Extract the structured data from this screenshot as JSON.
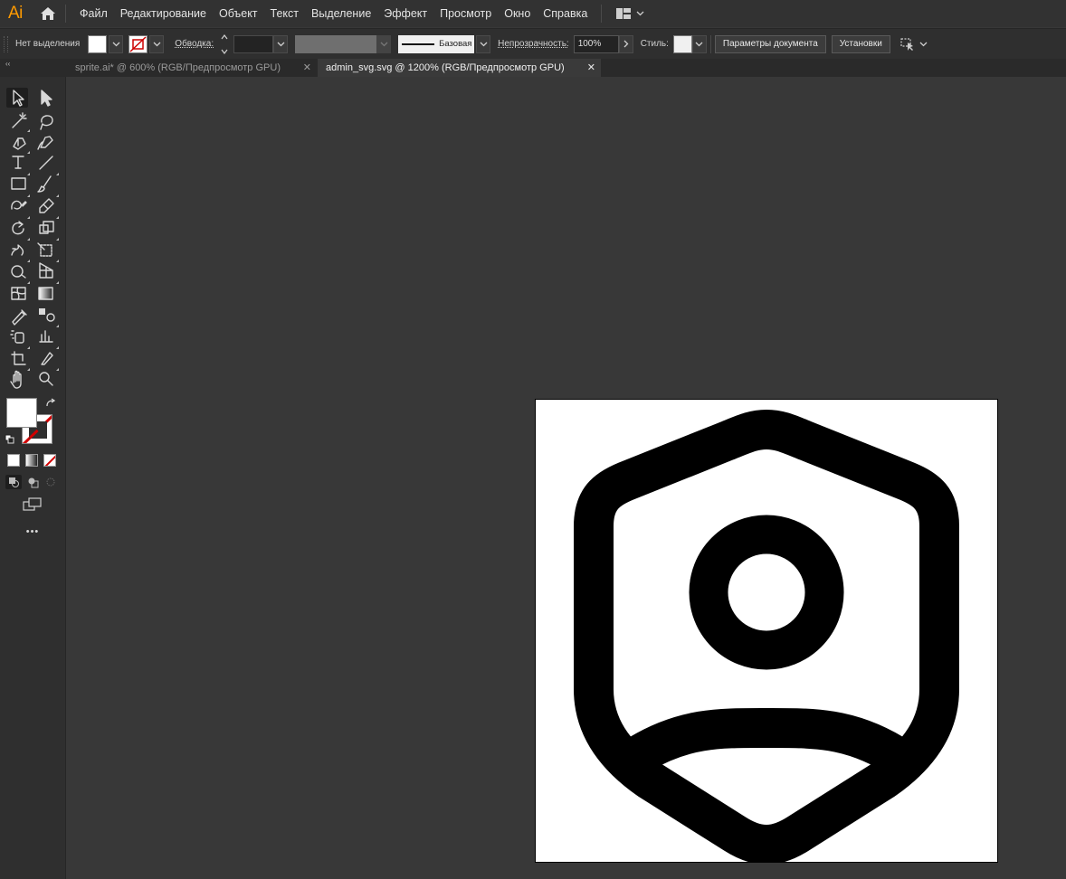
{
  "app": {
    "logo": "Ai"
  },
  "menu": [
    "Файл",
    "Редактирование",
    "Объект",
    "Текст",
    "Выделение",
    "Эффект",
    "Просмотр",
    "Окно",
    "Справка"
  ],
  "control_bar": {
    "selection_label": "Нет выделения",
    "stroke_label": "Обводка:",
    "stroke_style": "Базовая",
    "opacity_label": "Непрозрачность:",
    "opacity_value": "100%",
    "style_label": "Стиль:",
    "doc_setup_button": "Параметры документа",
    "preferences_button": "Установки"
  },
  "tabs": [
    {
      "label": "sprite.ai* @ 600% (RGB/Предпросмотр GPU)",
      "active": false
    },
    {
      "label": "admin_svg.svg @ 1200% (RGB/Предпросмотр GPU)",
      "active": true
    }
  ],
  "toolbar": {
    "more_label": "•••"
  },
  "colors": {
    "accent": "#ff9a00",
    "fill": "#ffffff",
    "stroke": "none",
    "background": "#383838"
  }
}
